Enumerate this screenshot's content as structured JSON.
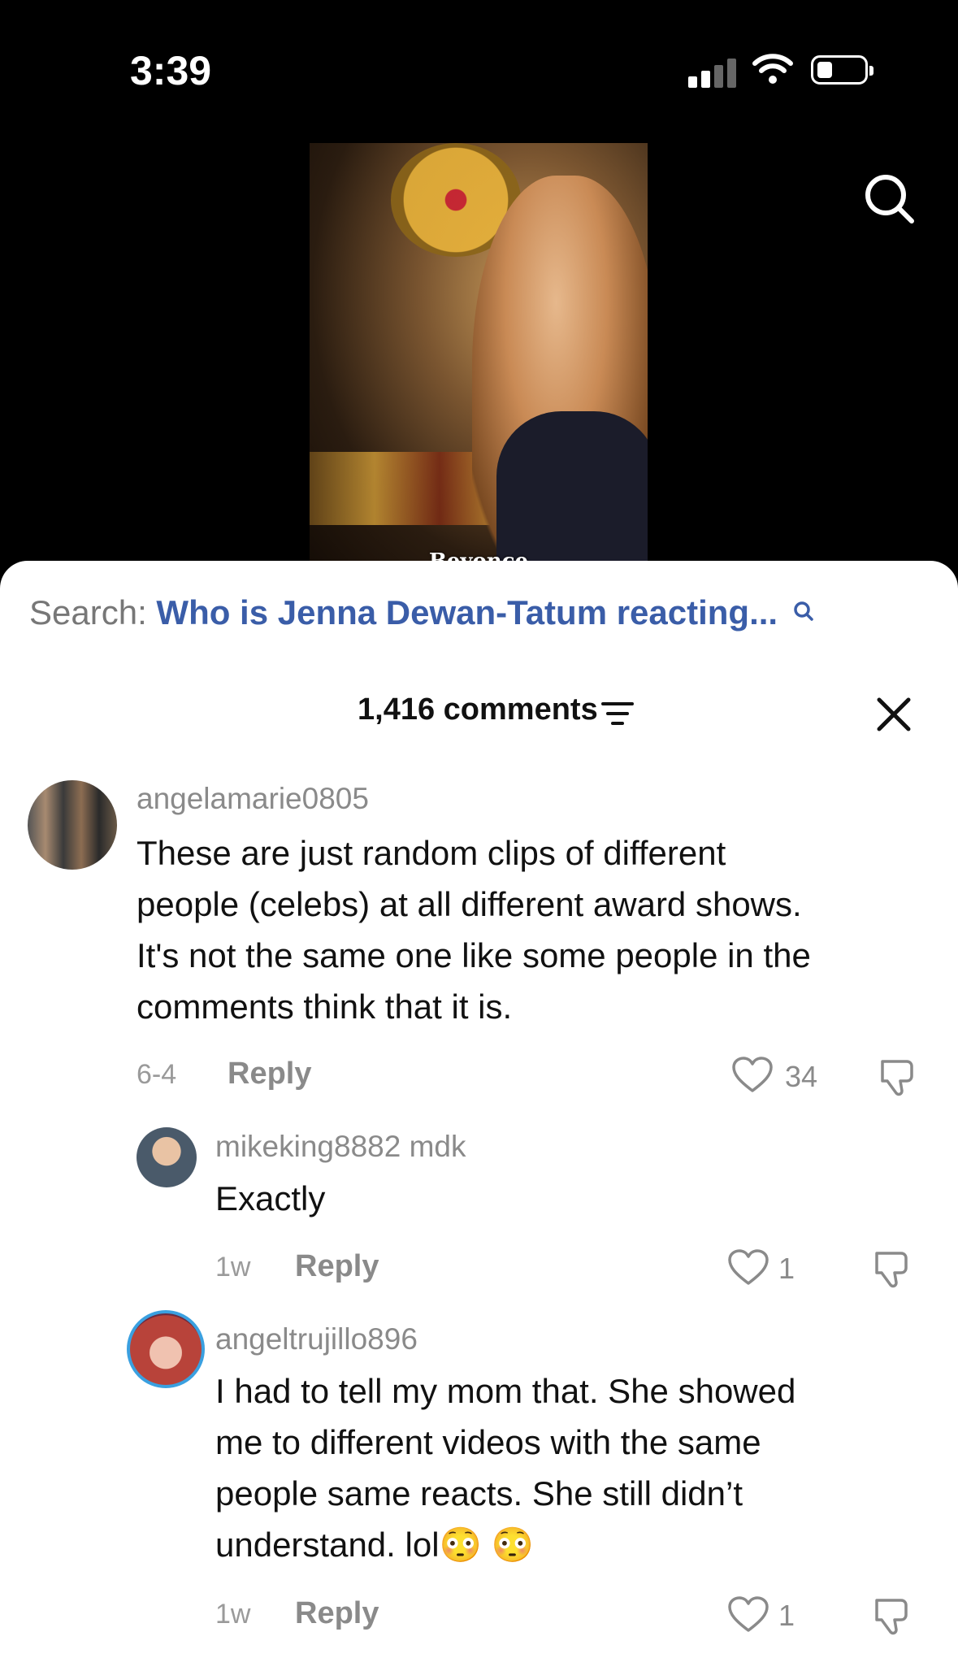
{
  "status_bar": {
    "time": "3:39"
  },
  "video": {
    "caption": "Beyonce"
  },
  "search_suggestion": {
    "label": "Search:",
    "query": "Who is Jenna Dewan-Tatum reacting..."
  },
  "comments_header": {
    "count_label": "1,416 comments"
  },
  "comments": [
    {
      "username": "angelamarie0805",
      "text_lines": [
        "These are just random clips of different",
        "people (celebs) at all different award shows.",
        "It's not the same one like some people in the",
        "comments think that it is."
      ],
      "date": "6-4",
      "reply_label": "Reply",
      "likes": "34"
    },
    {
      "username": "mikeking8882 mdk",
      "text_lines": [
        "Exactly"
      ],
      "date": "1w",
      "reply_label": "Reply",
      "likes": "1"
    },
    {
      "username": "angeltrujillo896",
      "text_lines": [
        "I had to tell my mom that. She showed",
        "me to different videos with the same",
        "people same reacts. She still didn’t",
        "understand. lol😳 😳"
      ],
      "date": "1w",
      "reply_label": "Reply",
      "likes": "1"
    }
  ]
}
